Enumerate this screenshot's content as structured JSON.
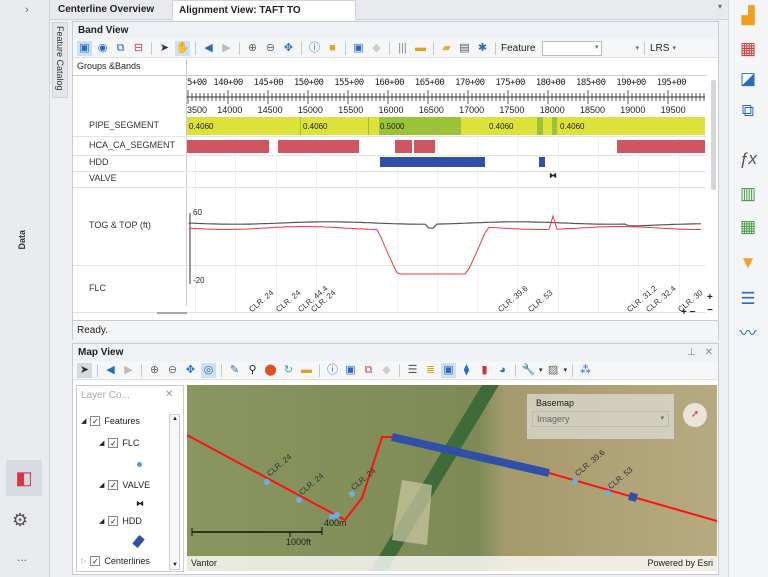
{
  "left_strip": {
    "data_label": "Data",
    "more": "..."
  },
  "tabs": [
    {
      "label": "Centerline Overview"
    },
    {
      "label": "Alignment View: TAFT TO INGLESIC"
    }
  ],
  "feature_catalog": "Feature Catalog",
  "band_view": {
    "title": "Band View",
    "feature_label": "Feature",
    "feature_value": "",
    "lrs_label": "LRS",
    "groups_bands": "Groups &Bands",
    "station_labels": [
      "5+00",
      "140+00",
      "145+00",
      "150+00",
      "155+00",
      "160+00",
      "165+00",
      "170+00",
      "175+00",
      "180+00",
      "185+00",
      "190+00",
      "195+00"
    ],
    "measure_labels": [
      "3500",
      "14000",
      "14500",
      "15000",
      "15500",
      "16000",
      "16500",
      "17000",
      "17500",
      "18000",
      "18500",
      "19000",
      "19500"
    ],
    "bands": [
      "PIPE_SEGMENT",
      "HCA_CA_SEGMENT",
      "HDD",
      "VALVE",
      "TOG & TOP (ft)",
      "FLC"
    ],
    "pipe_values": [
      "0.4060",
      "0.4060",
      "0.5000",
      "0.4060",
      "0.4060"
    ],
    "tog_axis": {
      "max": "60",
      "min": "-20"
    },
    "flc_labels": [
      "CLR. 24",
      "CLR. 24",
      "CLR. 44.4",
      "CLR. 24",
      "CLR. 39.6",
      "CLR. 53",
      "CLR. 31.2",
      "CLR. 32.4",
      "CLR. 30"
    ],
    "status": "Ready.",
    "colors": {
      "pipe": "#dde23a",
      "pipe_dark": "#9cc23a",
      "hca": "#cf5560",
      "hdd": "#2f4fa8",
      "tog": "#555555",
      "top": "#f03a3a"
    }
  },
  "map_view": {
    "title": "Map View",
    "layer_panel": {
      "title": "Layer Co...",
      "items": [
        "Features",
        "FLC",
        "VALVE",
        "HDD",
        "Centerlines"
      ]
    },
    "basemap": {
      "title": "Basemap",
      "value": "Imagery"
    },
    "labels": [
      "CLR. 24",
      "CLR. 24",
      "CLR. 24",
      "CLR. 39.6",
      "CLR. 53"
    ],
    "scale": {
      "metric": "400m",
      "imperial": "1000ft"
    },
    "attribution_left": "Vantor",
    "attribution_right": "Powered by Esri"
  }
}
